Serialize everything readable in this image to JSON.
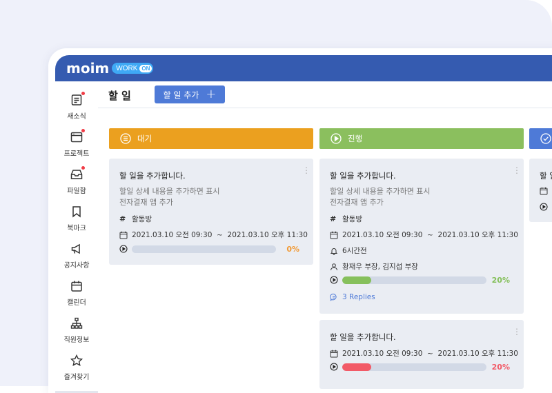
{
  "app": {
    "logo_text": "moim",
    "badge_text": "WORK",
    "badge_on": "ON"
  },
  "sidebar": {
    "items": [
      {
        "label": "새소식",
        "icon": "news-icon",
        "dot": true
      },
      {
        "label": "프로젝트",
        "icon": "project-icon",
        "dot": true
      },
      {
        "label": "파일함",
        "icon": "file-box-icon",
        "dot": true
      },
      {
        "label": "북마크",
        "icon": "bookmark-icon",
        "dot": false
      },
      {
        "label": "공지사항",
        "icon": "megaphone-icon",
        "dot": false
      },
      {
        "label": "캘린더",
        "icon": "calendar-icon",
        "dot": false
      },
      {
        "label": "직원정보",
        "icon": "org-chart-icon",
        "dot": false
      },
      {
        "label": "즐겨찾기",
        "icon": "star-icon",
        "dot": false
      }
    ]
  },
  "topbar": {
    "title": "할 일",
    "add_button": "할 일 추가",
    "add_icon": "plus-icon"
  },
  "colors": {
    "header": "#355bb0",
    "waiting": "#eba01f",
    "in_progress": "#8bbf5e",
    "done": "#4e7ad7",
    "progress_orange": "#f29a35",
    "progress_green": "#86c05c",
    "progress_red": "#f25a67"
  },
  "columns": [
    {
      "title": "대기",
      "icon": "list-icon",
      "cards": [
        {
          "title": "할 일을 추가합니다.",
          "desc_line1": "할일 상세 내용을 추가하면 표시",
          "desc_line2": "전자결재 앱 추가",
          "channel": "활동방",
          "date_range": "2021.03.10 오전 09:30  ~  2021.03.10 오후 11:30",
          "progress": 0,
          "progress_label": "0%"
        }
      ]
    },
    {
      "title": "진행",
      "icon": "play-icon",
      "cards": [
        {
          "title": "할 일을 추가합니다.",
          "desc_line1": "할일 상세 내용을 추가하면 표시",
          "desc_line2": "전자결재 앱 추가",
          "channel": "활동방",
          "date_range": "2021.03.10 오전 09:30  ~  2021.03.10 오후 11:30",
          "reminder": "6시간전",
          "assignees": "황재우 부장, 김지섭 부장",
          "progress": 20,
          "progress_label": "20%",
          "replies": "3 Replies"
        },
        {
          "title": "할 일을 추가합니다.",
          "date_range": "2021.03.10 오전 09:30  ~  2021.03.10 오후 11:30",
          "progress": 20,
          "progress_label": "20%"
        }
      ]
    },
    {
      "title": "",
      "icon": "check-circle-icon",
      "cards": [
        {
          "title": "할 일"
        }
      ]
    }
  ]
}
